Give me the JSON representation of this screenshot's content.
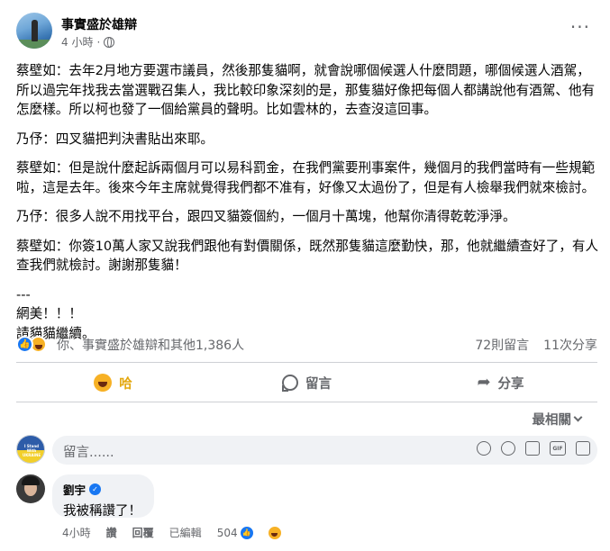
{
  "post": {
    "page_name": "事實盛於雄辯",
    "time": "4 小時",
    "time_sep": "·",
    "paragraphs": [
      "蔡壁如：去年2月地方要選市議員，然後那隻貓啊，就會說哪個候選人什麼問題，哪個候選人酒駕，所以過完年找我去當選戰召集人，我比較印象深刻的是，那隻貓好像把每個人都講說他有酒駕、他有怎麼樣。所以柯也發了一個給黨員的聲明。比如雲林的，去查沒這回事。",
      "乃伃：四叉貓把判決書貼出來耶。",
      "蔡壁如：但是說什麼起訴兩個月可以易科罰金，在我們黨要刑事案件，幾個月的我們當時有一些規範啦，這是去年。後來今年主席就覺得我們都不准有，好像又太過份了，但是有人檢舉我們就來檢討。",
      "乃伃：很多人說不用找平台，跟四叉貓簽個約，一個月十萬塊，他幫你清得乾乾淨淨。",
      "蔡壁如：你簽10萬人家又說我們跟他有對價關係，既然那隻貓這麼勤快，那，他就繼續查好了，有人查我們就檢討。謝謝那隻貓！"
    ],
    "closing": [
      "---",
      "網美！！！",
      "請貓貓繼續。"
    ]
  },
  "reactions": {
    "summary": "你、事實盛於雄辯和其他1,386人",
    "comments_count": "72則留言",
    "shares_count": "11次分享"
  },
  "actions": {
    "haha_label": "哈",
    "comment_label": "留言",
    "share_label": "分享"
  },
  "comments_section": {
    "sort_label": "最相關",
    "input_placeholder": "留言......",
    "my_avatar_text": "I Stand With UKRAINE"
  },
  "comment": {
    "author": "劉宇",
    "text": "我被稱讚了！",
    "time": "4小時",
    "like_label": "讚",
    "reply_label": "回覆",
    "edited_label": "已編輯",
    "reaction_count": "504"
  },
  "colors": {
    "accent": "#1877f2",
    "haha": "#f7b125",
    "muted_text": "#65676b",
    "bubble_bg": "#f0f2f5"
  }
}
